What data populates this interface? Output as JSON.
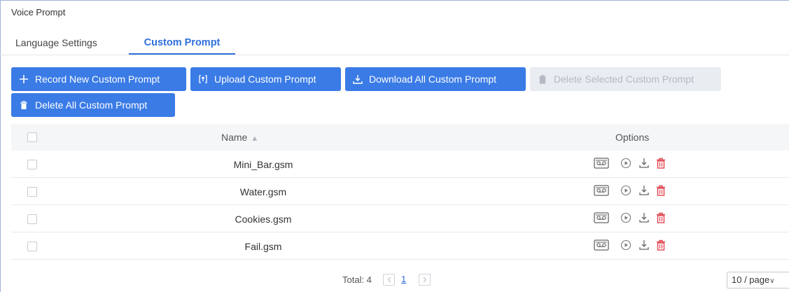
{
  "page": {
    "title": "Voice Prompt"
  },
  "tabs": [
    {
      "label": "Language Settings",
      "active": false
    },
    {
      "label": "Custom Prompt",
      "active": true
    }
  ],
  "toolbar": {
    "record_label": "Record New Custom Prompt",
    "upload_label": "Upload Custom Prompt",
    "download_all_label": "Download All Custom Prompt",
    "delete_selected_label": "Delete Selected Custom Prompt",
    "delete_all_label": "Delete All Custom Prompt"
  },
  "table": {
    "columns": {
      "name": "Name",
      "options": "Options"
    },
    "rows": [
      {
        "name": "Mini_Bar.gsm"
      },
      {
        "name": "Water.gsm"
      },
      {
        "name": "Cookies.gsm"
      },
      {
        "name": "Fail.gsm"
      }
    ]
  },
  "pagination": {
    "total_label": "Total: 4",
    "current_page": "1",
    "page_size": "10 / page"
  },
  "icons": {
    "record": "plus-icon",
    "upload": "upload-icon",
    "download": "download-icon",
    "delete": "trash-icon",
    "row_options": [
      "voicemail-icon",
      "play-icon",
      "download-icon",
      "trash-icon"
    ]
  },
  "colors": {
    "accent": "#3a7be6",
    "tab_active": "#2f6fdc",
    "delete_icon": "#e0464f",
    "disabled_bg": "#e9ecf1"
  }
}
